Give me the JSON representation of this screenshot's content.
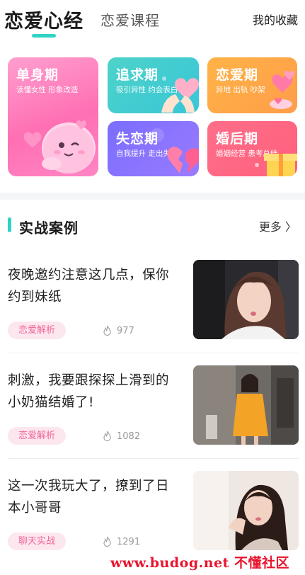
{
  "header": {
    "tab_active": "恋爱心经",
    "tab_inactive": "恋爱课程",
    "favorites": "我的收藏"
  },
  "categories": [
    {
      "title": "单身期",
      "subtitle": "读懂女性 形象改造"
    },
    {
      "title": "追求期",
      "subtitle": "吸引异性 约会表白"
    },
    {
      "title": "恋爱期",
      "subtitle": "异地 出轨 吵架"
    },
    {
      "title": "失恋期",
      "subtitle": "自我提升 走出失恋"
    },
    {
      "title": "婚后期",
      "subtitle": "婚姻经营 患考总结"
    }
  ],
  "section": {
    "title": "实战案例",
    "more": "更多 〉"
  },
  "articles": [
    {
      "title": "夜晚邀约注意这几点，保你约到妹纸",
      "tag": "恋爱解析",
      "views": "977"
    },
    {
      "title": "刺激，我要跟探探上滑到的小奶猫结婚了!",
      "tag": "恋爱解析",
      "views": "1082"
    },
    {
      "title": "这一次我玩大了，撩到了日本小哥哥",
      "tag": "聊天实战",
      "views": "1291"
    }
  ],
  "watermark": "www.budog.net 不懂社区",
  "colors": {
    "accent": "#2ed3c4",
    "tag_text": "#f0679b",
    "tag_bg": "#fde7ef"
  }
}
